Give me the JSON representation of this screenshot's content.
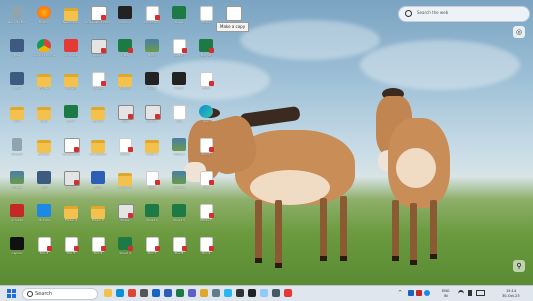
{
  "desktop": {
    "search": {
      "placeholder": "Search the web"
    },
    "tooltip": "Make a copy",
    "copilot_icon": "copilot-icon",
    "icons": [
      {
        "label": "Recycle Bin",
        "type": "bin"
      },
      {
        "label": "Firefox",
        "type": "ff"
      },
      {
        "label": "New folder",
        "type": "folder"
      },
      {
        "label": "Screenshot 2023",
        "type": "shot",
        "badge": true
      },
      {
        "label": "Capture",
        "type": "dark"
      },
      {
        "label": "Document",
        "type": "doc",
        "badge": true
      },
      {
        "label": "Sheet",
        "type": "excel"
      },
      {
        "label": "Notes",
        "type": "doc"
      },
      {
        "label": "Image",
        "type": "shot"
      },
      {
        "label": "Files",
        "type": "app"
      },
      {
        "label": "Google Chrome",
        "type": "chrome"
      },
      {
        "label": "AnyDesk",
        "type": "red"
      },
      {
        "label": "Report",
        "type": "grid",
        "badge": true
      },
      {
        "label": "Data",
        "type": "excel",
        "badge": true
      },
      {
        "label": "Photo",
        "type": "img"
      },
      {
        "label": "Letter",
        "type": "doc",
        "badge": true
      },
      {
        "label": "Budget",
        "type": "excel",
        "badge": true
      },
      {
        "label": "Drive",
        "type": "app"
      },
      {
        "label": "Folder",
        "type": "folder"
      },
      {
        "label": "Project",
        "type": "folder"
      },
      {
        "label": "Invoice",
        "type": "doc",
        "badge": true
      },
      {
        "label": "Archive",
        "type": "folder"
      },
      {
        "label": "Media",
        "type": "dark"
      },
      {
        "label": "Adobe",
        "type": "dark"
      },
      {
        "label": "Form",
        "type": "doc",
        "badge": true
      },
      {
        "label": "Work",
        "type": "folder"
      },
      {
        "label": "Docs",
        "type": "folder"
      },
      {
        "label": "Excel",
        "type": "excel"
      },
      {
        "label": "Shared",
        "type": "folder"
      },
      {
        "label": "Scan",
        "type": "grid",
        "badge": true
      },
      {
        "label": "Scan 2",
        "type": "grid",
        "badge": true
      },
      {
        "label": "Text",
        "type": "doc"
      },
      {
        "label": "App",
        "type": "edge"
      },
      {
        "label": "Recycle",
        "type": "bin"
      },
      {
        "label": "Backup",
        "type": "folder"
      },
      {
        "label": "Screenshot",
        "type": "shot",
        "badge": true
      },
      {
        "label": "Downloads",
        "type": "folder"
      },
      {
        "label": "Memo",
        "type": "doc",
        "badge": true
      },
      {
        "label": "Folder 2",
        "type": "folder"
      },
      {
        "label": "Photo 2",
        "type": "img"
      },
      {
        "label": "Doc 3",
        "type": "doc",
        "badge": true
      },
      {
        "label": "Images",
        "type": "img"
      },
      {
        "label": "Tool",
        "type": "app"
      },
      {
        "label": "Scan 3",
        "type": "grid",
        "badge": true
      },
      {
        "label": "Word",
        "type": "word"
      },
      {
        "label": "Folder 3",
        "type": "folder"
      },
      {
        "label": "Page",
        "type": "doc",
        "badge": true
      },
      {
        "label": "Picture",
        "type": "img"
      },
      {
        "label": "List",
        "type": "doc",
        "badge": true
      },
      {
        "label": "Acrobat",
        "type": "pdf"
      },
      {
        "label": "VS Code",
        "type": "vs"
      },
      {
        "label": "Folder 4",
        "type": "folder"
      },
      {
        "label": "Folder 5",
        "type": "folder"
      },
      {
        "label": "Slides",
        "type": "grid",
        "badge": true
      },
      {
        "label": "Sheet 2",
        "type": "excel"
      },
      {
        "label": "Sheet 3",
        "type": "excel"
      },
      {
        "label": "Notes 2",
        "type": "doc",
        "badge": true
      },
      {
        "label": "CapCut",
        "type": "cap"
      },
      {
        "label": "Doc 4",
        "type": "doc",
        "badge": true
      },
      {
        "label": "Doc 5",
        "type": "doc",
        "badge": true
      },
      {
        "label": "Doc 6",
        "type": "doc",
        "badge": true
      },
      {
        "label": "Sheet 4",
        "type": "excel",
        "badge": true
      },
      {
        "label": "Doc 7",
        "type": "doc",
        "badge": true
      },
      {
        "label": "Doc 8",
        "type": "doc",
        "badge": true
      },
      {
        "label": "Doc 9",
        "type": "doc",
        "badge": true
      }
    ]
  },
  "taskbar": {
    "search_placeholder": "Search",
    "apps": [
      "file-explorer-icon",
      "edge-icon",
      "chrome-icon",
      "store-icon",
      "mail-icon",
      "word-icon",
      "excel-icon",
      "teams-icon",
      "folder-icon",
      "settings-icon",
      "photos-icon",
      "camera-icon",
      "terminal-icon",
      "notepad-icon",
      "calculator-icon",
      "snipping-icon"
    ],
    "tray": {
      "lang": "ENG",
      "region": "IN",
      "time": "15:14",
      "date": "30-Oct-23"
    }
  },
  "colors": {
    "taskbar_bg": "#dfe6ee",
    "accent": "#1e6fd9"
  }
}
